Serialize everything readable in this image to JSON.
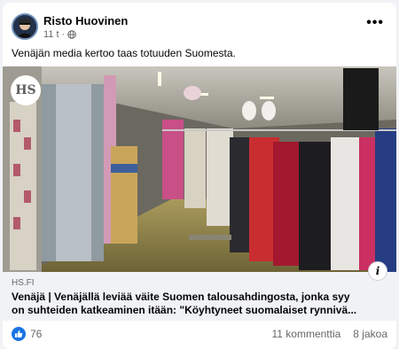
{
  "post": {
    "author": "Risto Huovinen",
    "time": "11 t",
    "separator": "·",
    "text": "Venäjän media kertoo taas totuuden Suomesta.",
    "more_label": "•••"
  },
  "link": {
    "publisher_badge": "HS",
    "domain": "HS.FI",
    "headline_line1": "Venäjä | Venäjällä leviää väite Suomen talousahdingosta, jonka syy",
    "headline_line2": "on suhteiden katkeaminen itään: \"Köyhtyneet suomalaiset rynnivä...",
    "info_label": "i"
  },
  "footer": {
    "likes": "76",
    "comments": "11 kommenttia",
    "shares": "8 jakoa"
  },
  "colors": {
    "like_blue": "#1b74e4",
    "secondary_text": "#65676b",
    "link_background": "#f0f2f5"
  },
  "icons": {
    "globe": "globe-icon",
    "like": "thumbs-up-icon",
    "info": "info-icon",
    "more": "more-options-icon"
  }
}
